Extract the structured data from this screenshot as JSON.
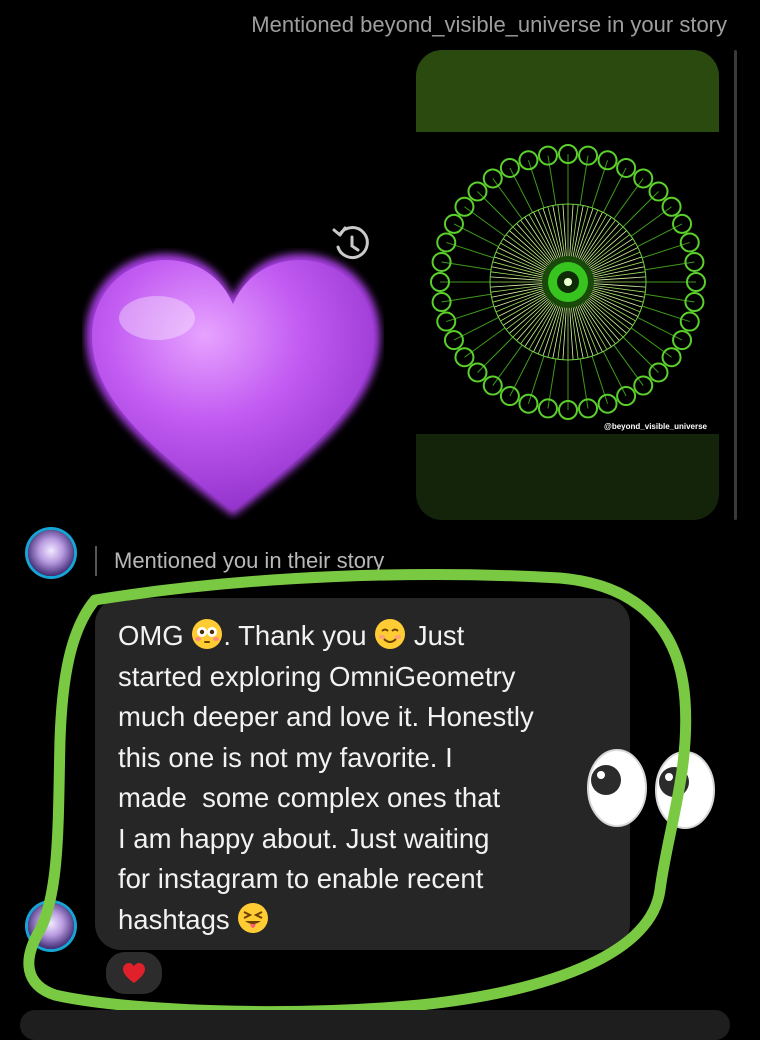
{
  "story_mention": {
    "header_text": "Mentioned beyond_visible_universe in your story",
    "watermark": "@beyond_visible_universe",
    "colors": {
      "band_top": "#2a4a10",
      "band_bottom": "#13240a",
      "art": "#7be04a"
    }
  },
  "sticker": {
    "heart": "purple-heart-icon",
    "eyes": "eyes-icon"
  },
  "icons": {
    "replay": "replay-clock-icon"
  },
  "reply": {
    "mention_text": "Mentioned you in their story",
    "message": {
      "omg": "OMG ",
      "thank": ". Thank you ",
      "part3": " Just\nstarted exploring OmniGeometry\nmuch deeper and love it. Honestly\nthis one is not my favorite. I\nmade  some complex ones that\nI am happy about. Just waiting\nfor instagram to enable recent\nhashtags "
    },
    "emojis": [
      "flushed-face-icon",
      "smiling-face-icon",
      "squinting-tongue-face-icon"
    ],
    "reaction": "red-heart-icon"
  },
  "highlight": {
    "color": "#7ac943"
  }
}
